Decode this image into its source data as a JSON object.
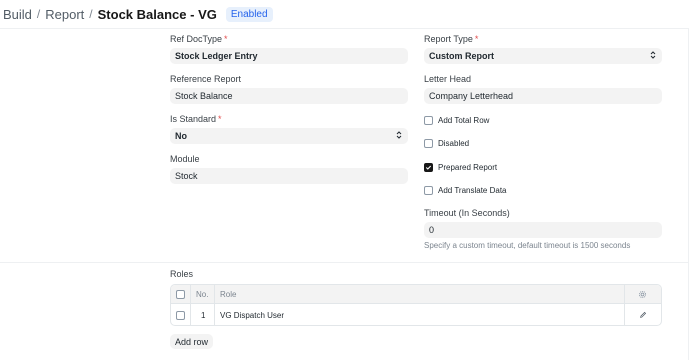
{
  "breadcrumb": {
    "items": [
      "Build",
      "Report"
    ],
    "title": "Stock Balance - VG",
    "status": "Enabled"
  },
  "form": {
    "ref_doctype": {
      "label": "Ref DocType",
      "value": "Stock Ledger Entry"
    },
    "reference_report": {
      "label": "Reference Report",
      "value": "Stock Balance"
    },
    "is_standard": {
      "label": "Is Standard",
      "value": "No"
    },
    "module": {
      "label": "Module",
      "value": "Stock"
    },
    "report_type": {
      "label": "Report Type",
      "value": "Custom Report"
    },
    "letter_head": {
      "label": "Letter Head",
      "value": "Company Letterhead"
    },
    "checkboxes": [
      {
        "label": "Add Total Row",
        "checked": false
      },
      {
        "label": "Disabled",
        "checked": false
      },
      {
        "label": "Prepared Report",
        "checked": true
      },
      {
        "label": "Add Translate Data",
        "checked": false
      }
    ],
    "timeout": {
      "label": "Timeout (In Seconds)",
      "value": "0",
      "help": "Specify a custom timeout, default timeout is 1500 seconds"
    }
  },
  "roles": {
    "label": "Roles",
    "columns": {
      "no": "No.",
      "role": "Role"
    },
    "rows": [
      {
        "no": "1",
        "role": "VG Dispatch User"
      }
    ],
    "add_row_label": "Add row"
  }
}
